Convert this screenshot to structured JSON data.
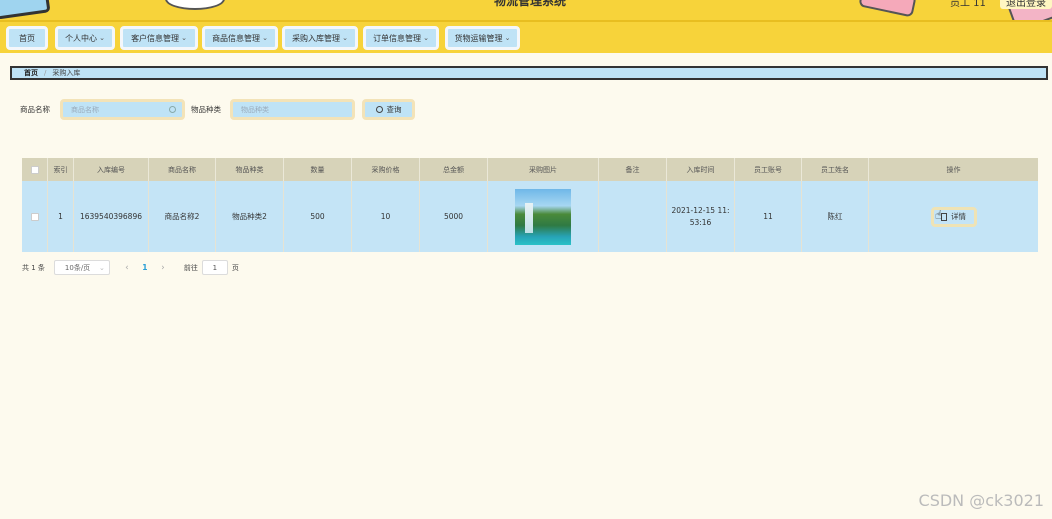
{
  "header": {
    "title": "物流管理系统",
    "user_label": "员工 11",
    "logout_label": "退出登录"
  },
  "nav": {
    "items": [
      {
        "label": "首页",
        "has_dropdown": false
      },
      {
        "label": "个人中心",
        "has_dropdown": true
      },
      {
        "label": "客户信息管理",
        "has_dropdown": true
      },
      {
        "label": "商品信息管理",
        "has_dropdown": true
      },
      {
        "label": "采购入库管理",
        "has_dropdown": true
      },
      {
        "label": "订单信息管理",
        "has_dropdown": true
      },
      {
        "label": "货物运输管理",
        "has_dropdown": true
      }
    ]
  },
  "breadcrumb": {
    "home": "首页",
    "separator": "/",
    "current": "采购入库"
  },
  "search": {
    "field1_label": "商品名称",
    "field1_placeholder": "商品名称",
    "field2_label": "物品种类",
    "field2_placeholder": "物品种类",
    "button_label": "查询"
  },
  "table": {
    "columns": [
      "索引",
      "入库编号",
      "商品名称",
      "物品种类",
      "数量",
      "采购价格",
      "总金额",
      "采购图片",
      "备注",
      "入库时间",
      "员工账号",
      "员工姓名",
      "操作"
    ],
    "rows": [
      {
        "index": "1",
        "stock_no": "1639540396896",
        "product_name": "商品名称2",
        "category": "物品种类2",
        "quantity": "500",
        "price": "10",
        "total": "5000",
        "remark": "",
        "time": "2021-12-15 11:53:16",
        "staff_account": "11",
        "staff_name": "陈红",
        "action_label": "详情"
      }
    ]
  },
  "pager": {
    "total": "共 1 条",
    "page_size": "10条/页",
    "current_page": "1",
    "goto_label": "前往",
    "goto_value": "1",
    "page_unit": "页"
  },
  "watermark": "CSDN @ck3021",
  "colors": {
    "header_yellow": "#f7d33a",
    "light_blue": "#bfe3f6",
    "table_head": "#d7d3b9",
    "background": "#fdfaee"
  }
}
